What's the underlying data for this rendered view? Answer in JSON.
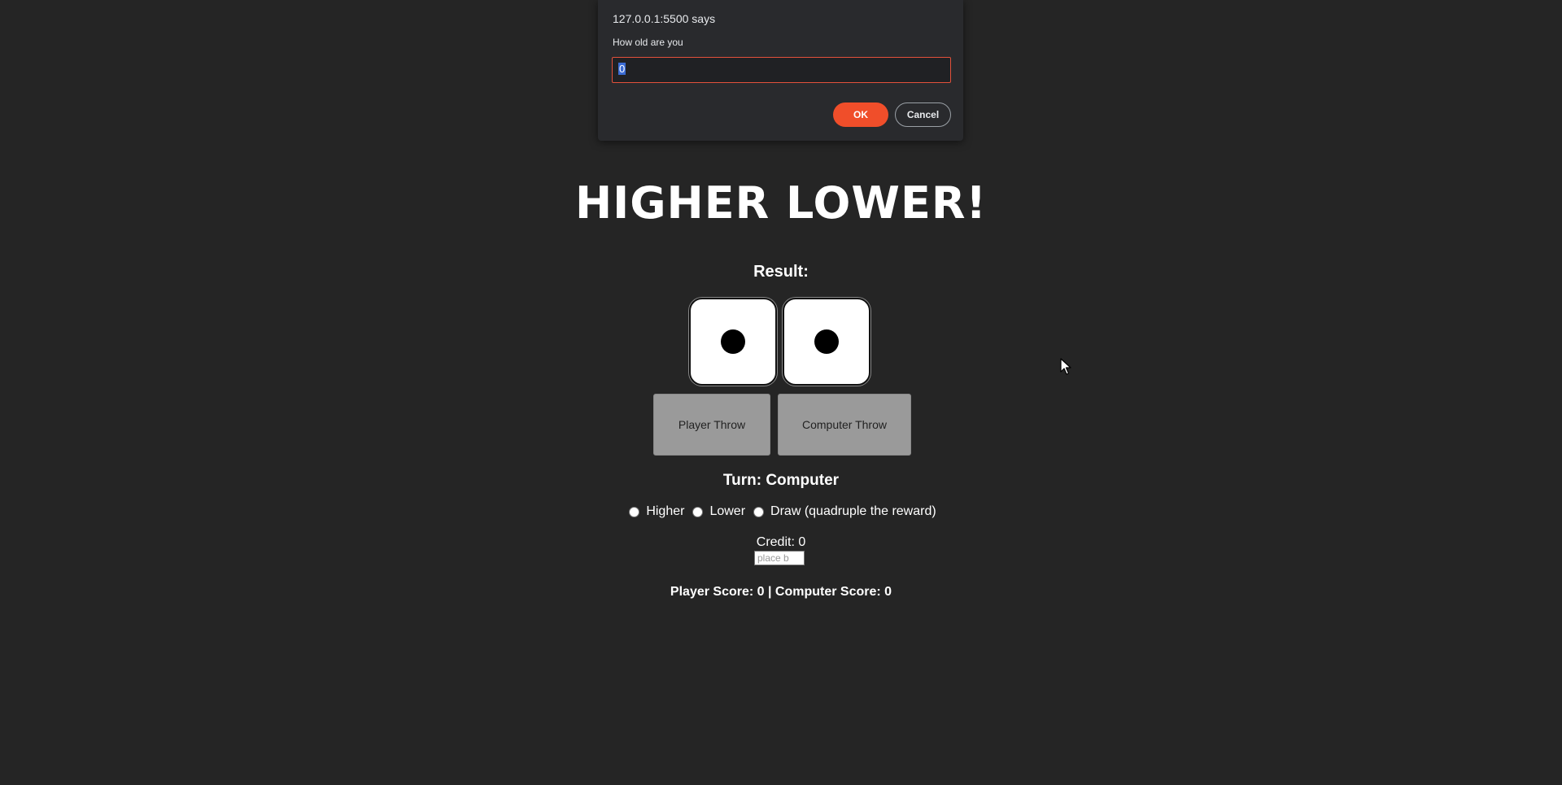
{
  "dialog": {
    "origin": "127.0.0.1:5500 says",
    "message": "How old are you",
    "input_value": "0",
    "ok_label": "OK",
    "cancel_label": "Cancel"
  },
  "game": {
    "title": "HIGHER LOWER!",
    "result_label": "Result:",
    "dice": [
      1,
      1
    ],
    "player_throw_label": "Player Throw",
    "computer_throw_label": "Computer Throw",
    "turn_text": "Turn: Computer",
    "options": [
      "Higher",
      "Lower",
      "Draw (quadruple the reward)"
    ],
    "credit_text": "Credit: 0",
    "bet_placeholder": "place b",
    "scores_text": "Player Score: 0 | Computer Score: 0"
  },
  "colors": {
    "background": "#252525",
    "dialog_bg": "#292a2d",
    "accent": "#f04e2a",
    "throw_button": "#9a9a9a"
  }
}
